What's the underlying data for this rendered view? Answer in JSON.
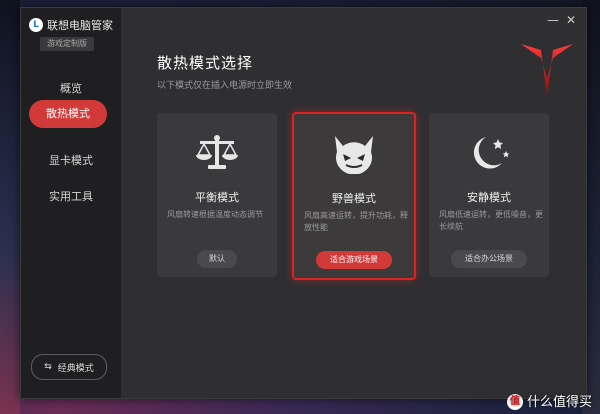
{
  "app": {
    "logo_letter": "L",
    "title": "联想电脑管家",
    "subtitle_badge": "游戏定制版",
    "window_controls": {
      "minimize": "—",
      "close": "✕"
    }
  },
  "sidebar": {
    "items": [
      {
        "label": "概览",
        "active": false
      },
      {
        "label": "散热模式",
        "active": true
      },
      {
        "label": "显卡模式",
        "active": false
      },
      {
        "label": "实用工具",
        "active": false
      }
    ],
    "classic_mode": {
      "icon": "switch-arrows-icon",
      "glyph": "⇆",
      "label": "经典模式"
    }
  },
  "main": {
    "title": "散热模式选择",
    "subtitle": "以下模式仅在插入电源时立即生效",
    "cards": [
      {
        "name": "平衡模式",
        "desc": "风扇转速根据温度动态调节",
        "button": "默认",
        "icon": "balance-scale-icon",
        "selected": false
      },
      {
        "name": "野兽模式",
        "desc": "风扇高速运转，提升功耗，释放性能",
        "button": "适合游戏场景",
        "icon": "beast-face-icon",
        "selected": true
      },
      {
        "name": "安静模式",
        "desc": "风扇低速运转，更低噪音，更长续航",
        "button": "适合办公场景",
        "icon": "moon-stars-icon",
        "selected": false
      }
    ]
  },
  "colors": {
    "accent": "#d23a3a",
    "sidebar_bg": "#1f1f21",
    "main_bg": "#2f2f32",
    "card_bg": "#3a3a3d"
  },
  "watermark": {
    "badge": "值",
    "text": "什么值得买"
  }
}
